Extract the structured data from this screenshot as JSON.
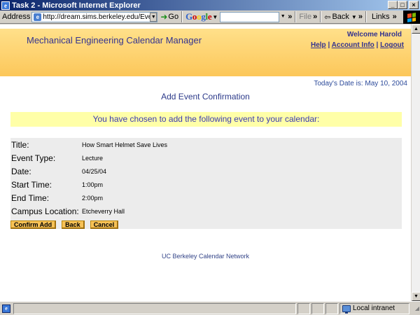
{
  "window": {
    "title": "Task 2 - Microsoft Internet Explorer",
    "min": "_",
    "max": "□",
    "close": "×"
  },
  "toolbar": {
    "address_label": "Address",
    "url": "http://dream.sims.berkeley.edu/EventCalenda",
    "go_label": "Go",
    "file_label": "File",
    "back_label": "Back",
    "links_label": "Links"
  },
  "banner": {
    "app_title": "Mechanical Engineering Calendar Manager",
    "welcome": "Welcome Harold",
    "links": [
      "Help",
      "Account Info",
      "Logout"
    ]
  },
  "date_line": "Today's Date is: May 10, 2004",
  "heading": "Add Event Confirmation",
  "notice": "You have chosen to add the following event to your calendar:",
  "event": [
    {
      "label": "Title:",
      "value": "How Smart Helmet Save Lives"
    },
    {
      "label": "Event Type:",
      "value": "Lecture"
    },
    {
      "label": "Date:",
      "value": "04/25/04"
    },
    {
      "label": "Start Time:",
      "value": "1:00pm"
    },
    {
      "label": "End Time:",
      "value": "2:00pm"
    },
    {
      "label": "Campus Location:",
      "value": "Etcheverry Hall"
    }
  ],
  "buttons": {
    "confirm": "Confirm Add",
    "back": "Back",
    "cancel": "Cancel"
  },
  "footer": "UC Berkeley Calendar Network",
  "statusbar": {
    "zone": "Local intranet"
  },
  "colors": {
    "banner": "#fcc75a",
    "notice": "#ffffa8",
    "button": "#f7c257",
    "link": "#33338f"
  }
}
